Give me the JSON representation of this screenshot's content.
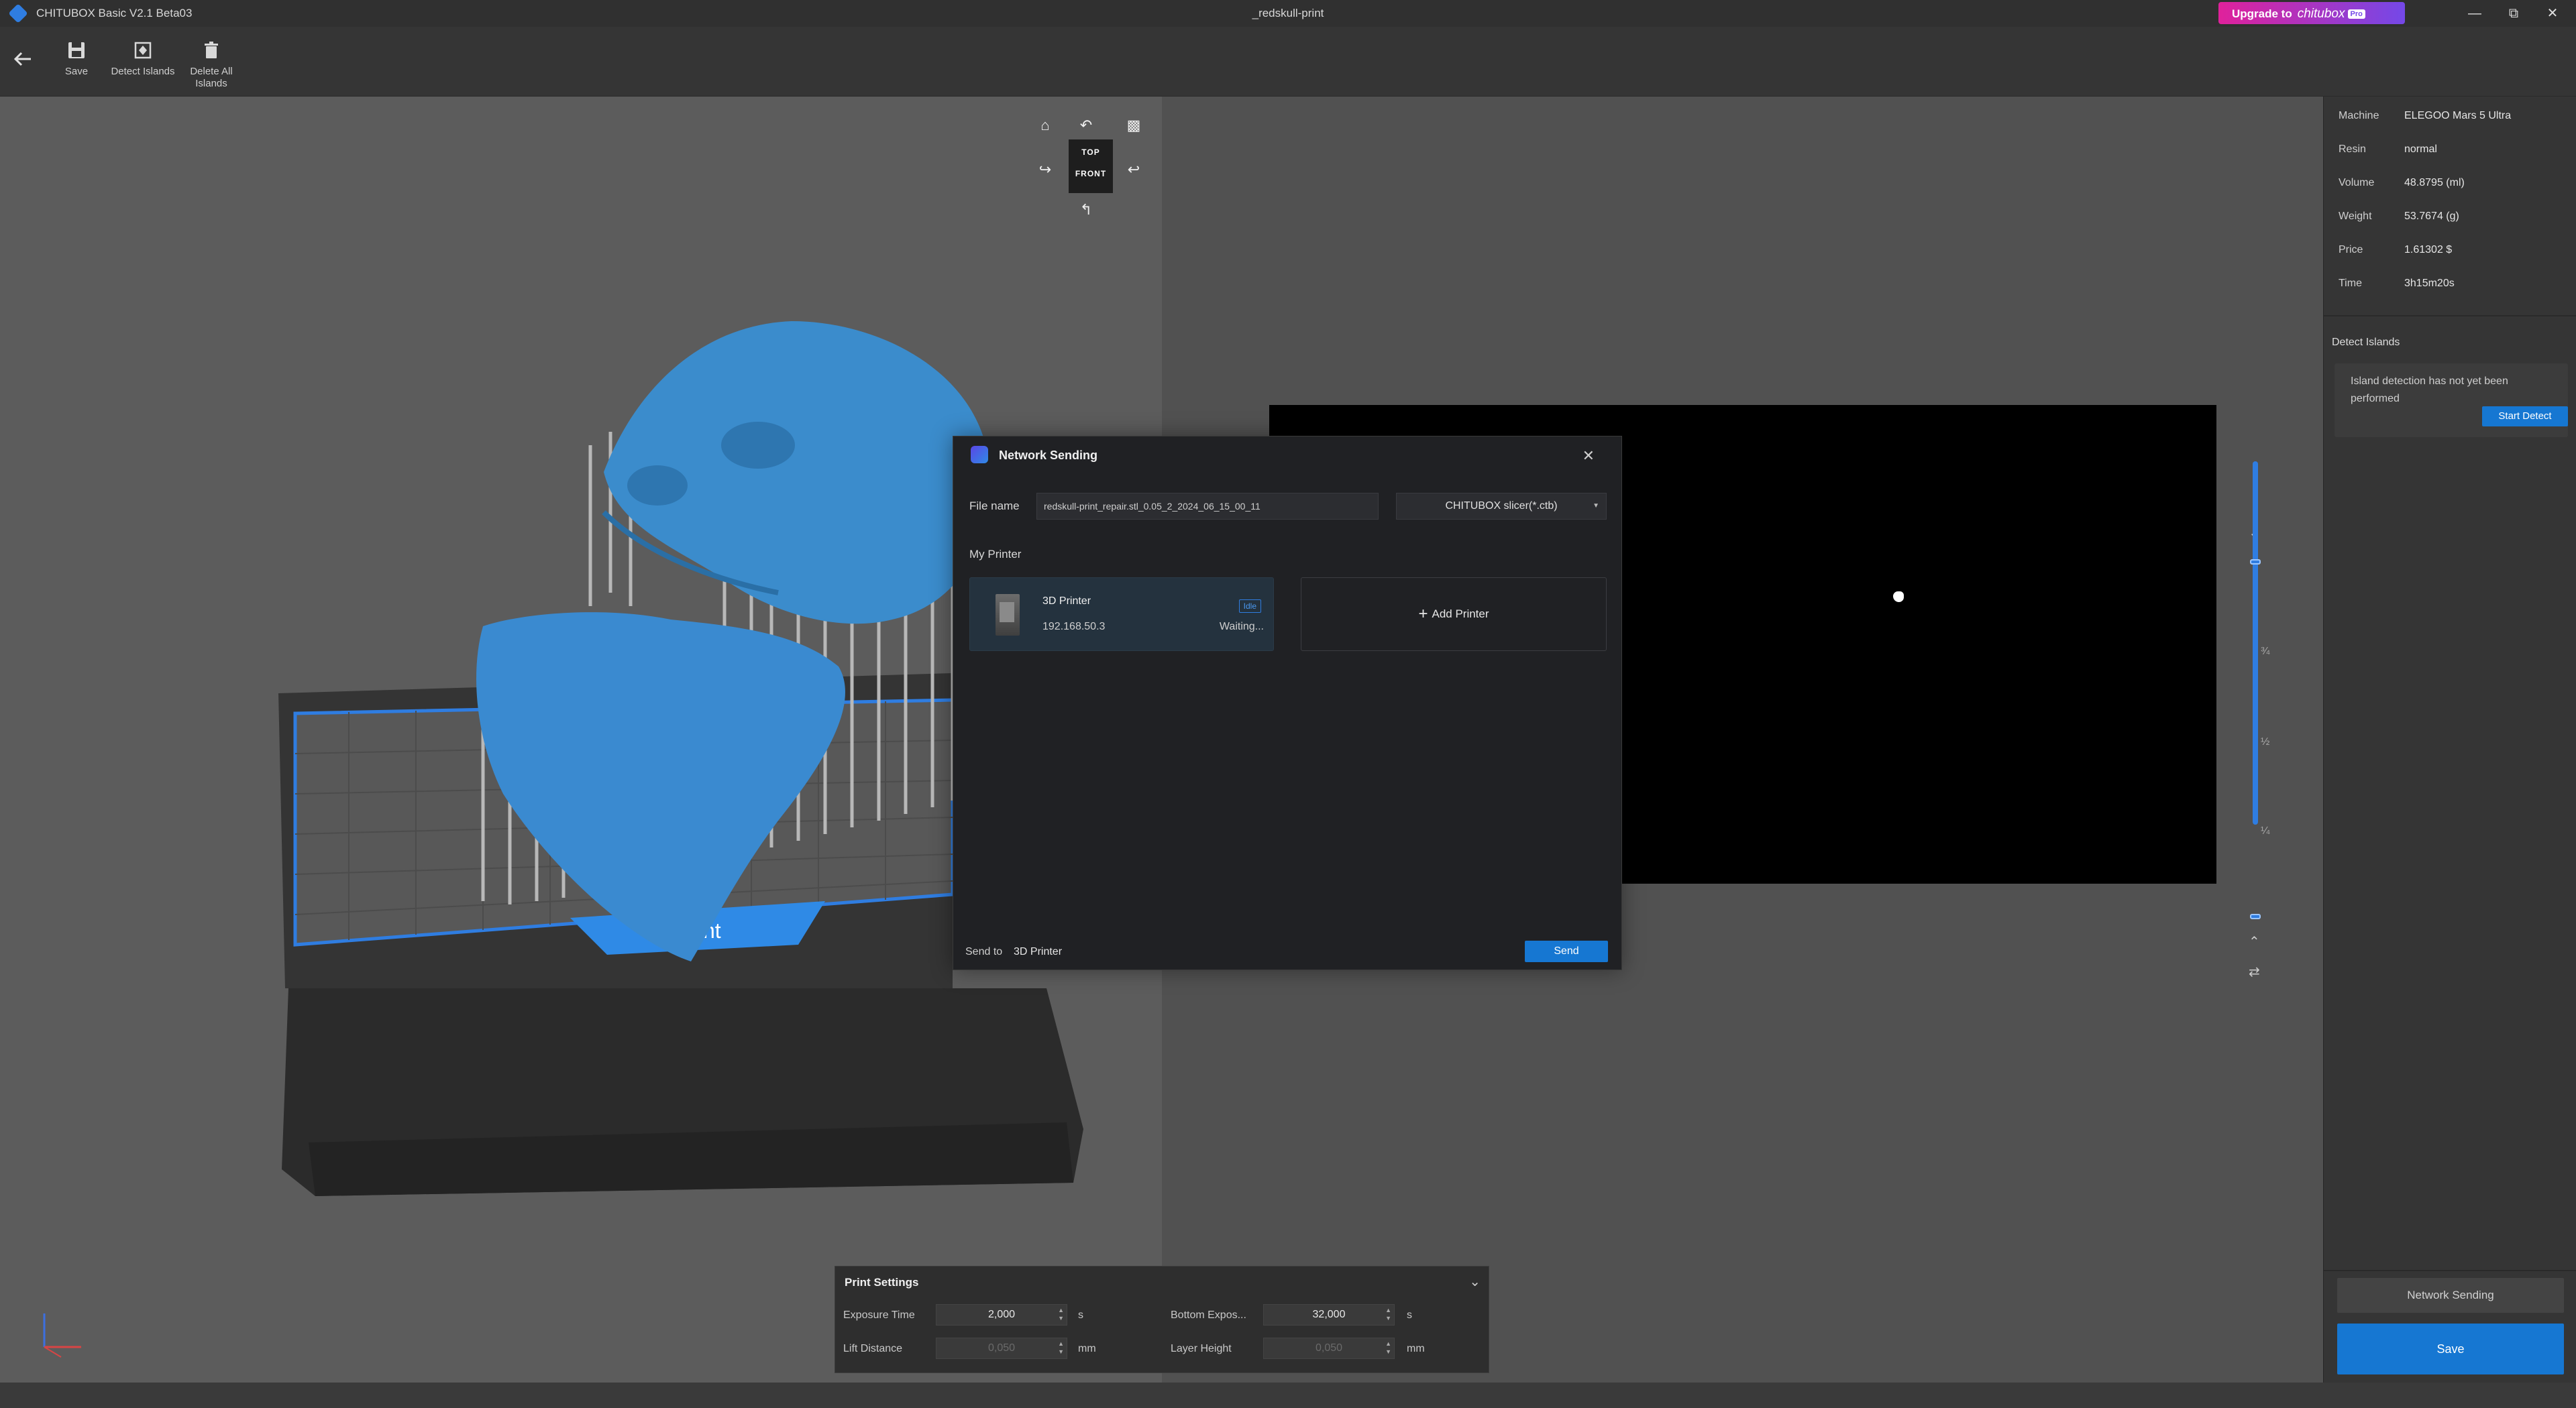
{
  "app": {
    "title": "CHITUBOX Basic V2.1 Beta03",
    "document_title": "_redskull-print",
    "upgrade_label": "Upgrade to",
    "upgrade_brand": "chitubox",
    "upgrade_badge": "Pro",
    "accent_color": "#1677d2"
  },
  "toolbar": {
    "items": [
      {
        "label": "Save",
        "icon": "save-icon"
      },
      {
        "label": "Detect Islands",
        "icon": "detect-islands-icon"
      },
      {
        "label": "Delete All Islands",
        "icon": "trash-icon"
      }
    ]
  },
  "viewport": {
    "viewcube": {
      "top": "TOP",
      "front": "FRONT"
    },
    "bed_label": "Front",
    "preview": {
      "ticks": [
        "¾",
        "½",
        "¼"
      ]
    }
  },
  "print_settings": {
    "title": "Print Settings",
    "fields": {
      "exposure_time": {
        "label": "Exposure Time",
        "value": "2,000",
        "unit": "s"
      },
      "bottom_exposure": {
        "label": "Bottom Expos...",
        "value": "32,000",
        "unit": "s"
      },
      "lift_distance": {
        "label": "Lift Distance",
        "value": "0,050",
        "unit": "mm"
      },
      "layer_height": {
        "label": "Layer Height",
        "value": "0,050",
        "unit": "mm"
      }
    }
  },
  "info": {
    "rows": [
      {
        "label": "Machine",
        "value": "ELEGOO Mars 5 Ultra"
      },
      {
        "label": "Resin",
        "value": "normal"
      },
      {
        "label": "Volume",
        "value": "48.8795 (ml)"
      },
      {
        "label": "Weight",
        "value": "53.7674 (g)"
      },
      {
        "label": "Price",
        "value": "1.61302 $"
      },
      {
        "label": "Time",
        "value": "3h15m20s"
      }
    ]
  },
  "detect_islands": {
    "title": "Detect Islands",
    "message": "Island detection has not yet been performed",
    "button": "Start Detect"
  },
  "right_actions": {
    "network_sending": "Network Sending",
    "save": "Save"
  },
  "dialog": {
    "title": "Network Sending",
    "file_name_label": "File name",
    "file_name_value": "redskull-print_repair.stl_0.05_2_2024_06_15_00_11",
    "format": "CHITUBOX slicer(*.ctb)",
    "my_printer_label": "My Printer",
    "printer": {
      "name": "3D Printer",
      "ip": "192.168.50.3",
      "badge": "Idle",
      "status": "Waiting..."
    },
    "add_printer": "Add Printer",
    "send_to_label": "Send to",
    "send_to_value": "3D Printer",
    "send_button": "Send"
  }
}
